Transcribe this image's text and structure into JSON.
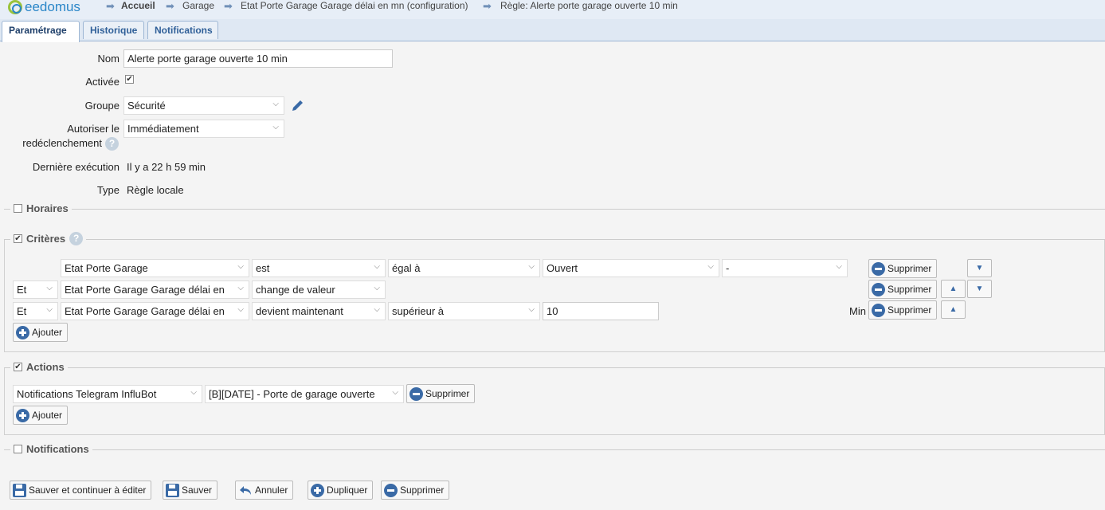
{
  "header": {
    "logo_text": "eedomus",
    "breadcrumb": [
      "Accueil",
      "Garage",
      "Etat Porte Garage Garage délai en mn (configuration)",
      "Règle: Alerte porte garage ouverte 10 min"
    ]
  },
  "tabs": [
    "Paramétrage",
    "Historique",
    "Notifications"
  ],
  "form": {
    "nom_label": "Nom",
    "nom_value": "Alerte porte garage ouverte 10 min",
    "activee_label": "Activée",
    "groupe_label": "Groupe",
    "groupe_value": "Sécurité",
    "autoriser_label_1": "Autoriser le",
    "autoriser_label_2": "redéclenchement",
    "autoriser_value": "Immédiatement",
    "derniere_label": "Dernière exécution",
    "derniere_value": "Il y a 22 h 59 min",
    "type_label": "Type",
    "type_value": "Règle locale"
  },
  "horaires": {
    "title": "Horaires"
  },
  "criteres": {
    "title": "Critères",
    "rows": [
      {
        "conj": "",
        "device": "Etat Porte Garage",
        "verb": "est",
        "op": "égal à",
        "value": "Ouvert",
        "extra": "-",
        "unit": ""
      },
      {
        "conj": "Et",
        "device": "Etat Porte Garage Garage délai en",
        "verb": "change de valeur",
        "op": "",
        "value": "",
        "extra": "",
        "unit": ""
      },
      {
        "conj": "Et",
        "device": "Etat Porte Garage Garage délai en",
        "verb": "devient maintenant",
        "op": "supérieur à",
        "value": "10",
        "extra": "",
        "unit": "Min"
      }
    ],
    "delete_label": "Supprimer",
    "add_label": "Ajouter"
  },
  "actions": {
    "title": "Actions",
    "device": "Notifications Telegram InfluBot",
    "action": "[B][DATE] - Porte de garage ouverte",
    "delete_label": "Supprimer",
    "add_label": "Ajouter"
  },
  "notifications": {
    "title": "Notifications"
  },
  "footer": {
    "save_continue": "Sauver et continuer à éditer",
    "save": "Sauver",
    "cancel": "Annuler",
    "duplicate": "Dupliquer",
    "delete": "Supprimer"
  }
}
